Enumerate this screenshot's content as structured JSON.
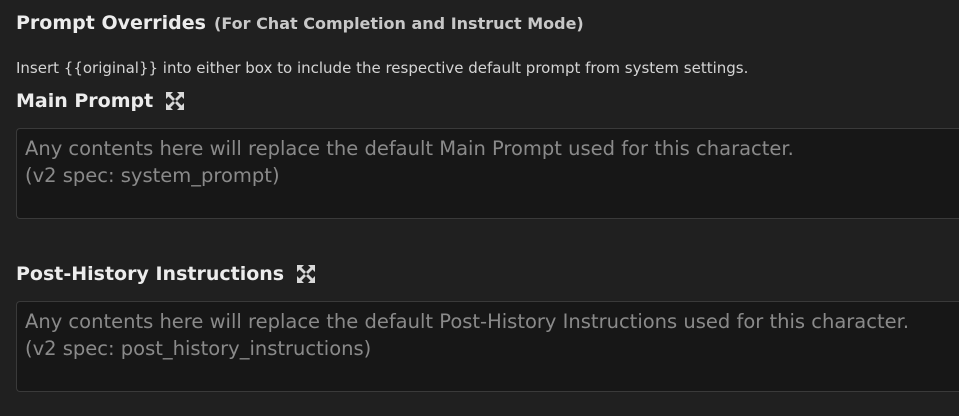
{
  "header": {
    "title": "Prompt Overrides",
    "subtitle": "(For Chat Completion and Instruct Mode)",
    "help_text": "Insert {{original}} into either box to include the respective default prompt from system settings."
  },
  "main_prompt": {
    "label": "Main Prompt",
    "expand_icon": "expand-arrows-icon",
    "placeholder": "Any contents here will replace the default Main Prompt used for this character.\n(v2 spec: system_prompt)",
    "value": ""
  },
  "post_history": {
    "label": "Post-History Instructions",
    "expand_icon": "expand-arrows-icon",
    "placeholder": "Any contents here will replace the default Post-History Instructions used for this character.\n(v2 spec: post_history_instructions)",
    "value": ""
  },
  "colors": {
    "background": "#202020",
    "textbox_bg": "#171717",
    "placeholder": "#8a8a8a",
    "heading": "#ececec"
  }
}
